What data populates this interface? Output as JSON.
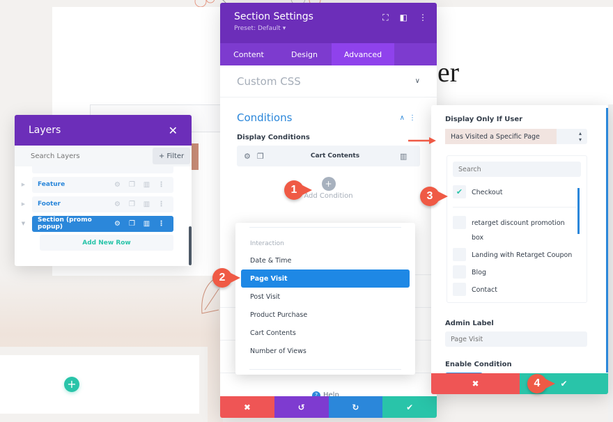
{
  "page": {
    "heading_fragment": "er"
  },
  "layers": {
    "title": "Layers",
    "search_placeholder": "Search Layers",
    "filter_label": "+ Filter",
    "items": [
      {
        "label": "Feature",
        "expanded": false,
        "active": false
      },
      {
        "label": "Footer",
        "expanded": false,
        "active": false
      },
      {
        "label": "Section (promo popup)",
        "expanded": true,
        "active": true
      }
    ],
    "add_row_label": "Add New Row"
  },
  "settings": {
    "title": "Section Settings",
    "preset": "Preset: Default ▾",
    "tabs": [
      {
        "label": "Content",
        "active": false
      },
      {
        "label": "Design",
        "active": false
      },
      {
        "label": "Advanced",
        "active": true
      }
    ],
    "custom_css_label": "Custom CSS",
    "conditions_label": "Conditions",
    "display_conditions_label": "Display Conditions",
    "existing_condition": "Cart Contents",
    "add_condition_label": "Add Condition",
    "help_label": "Help"
  },
  "dropdown": {
    "group_label": "Interaction",
    "items": [
      {
        "label": "Date & Time",
        "selected": false
      },
      {
        "label": "Page Visit",
        "selected": true
      },
      {
        "label": "Post Visit",
        "selected": false
      },
      {
        "label": "Product Purchase",
        "selected": false
      },
      {
        "label": "Cart Contents",
        "selected": false
      },
      {
        "label": "Number of Views",
        "selected": false
      }
    ]
  },
  "condition_panel": {
    "display_label": "Display Only If User",
    "display_value": "Has Visited a Specific Page",
    "search_placeholder": "Search",
    "pages": [
      {
        "label": "Checkout",
        "checked": true
      },
      {
        "label": "retarget discount promotion box",
        "checked": false
      },
      {
        "label": "Landing with Retarget Coupon",
        "checked": false
      },
      {
        "label": "Blog",
        "checked": false
      },
      {
        "label": "Contact",
        "checked": false
      }
    ],
    "admin_label_label": "Admin Label",
    "admin_label_placeholder": "Page Visit",
    "enable_label": "Enable Condition",
    "enabled": true
  },
  "icons": {
    "close": "✕",
    "cancel": "✖",
    "check": "✔",
    "undo": "↺",
    "redo": "↻",
    "plus": "+",
    "gear": "⚙",
    "copy": "❐",
    "trash": "🗑",
    "more": "⋮",
    "chevron_down": "⌄",
    "chevron_up": "⌃",
    "play_right": "▶",
    "play_down": "▼",
    "updown": "⬍",
    "expand": "⛶",
    "sidebar": "◧",
    "question": "?"
  },
  "markers": [
    "1",
    "2",
    "3",
    "4"
  ]
}
